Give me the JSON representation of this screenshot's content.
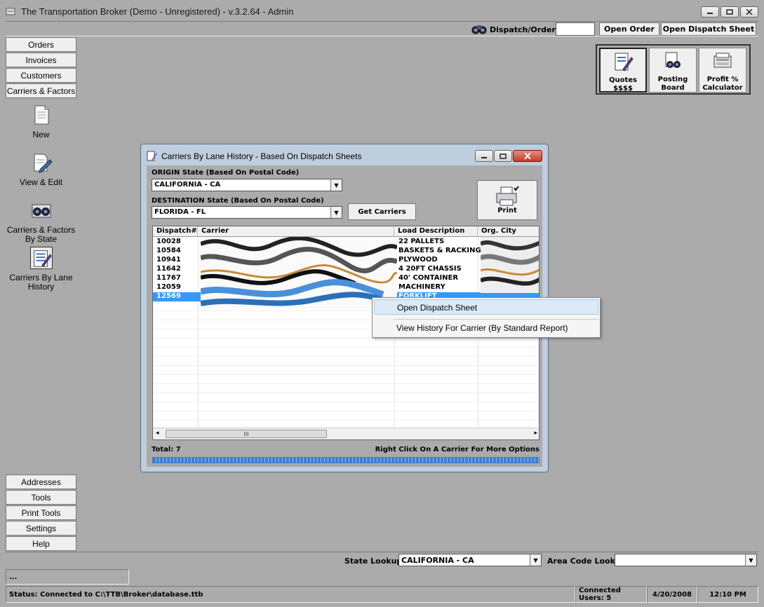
{
  "app": {
    "title": "The Transportation Broker (Demo - Unregistered) - v.3.2.64 - Admin"
  },
  "toolbar": {
    "dispatch_label": "Dispatch/Order #:",
    "dispatch_value": "",
    "open_order": "Open Order",
    "open_dispatch_sheet": "Open Dispatch Sheet"
  },
  "nav": {
    "top_buttons": [
      "Orders",
      "Invoices",
      "Customers",
      "Carriers & Factors"
    ],
    "icons": [
      {
        "label": "New",
        "icon": "new-document-icon"
      },
      {
        "label": "View & Edit",
        "icon": "edit-document-icon"
      },
      {
        "label": "Carriers & Factors By State",
        "icon": "truck-icon"
      },
      {
        "label": "Carriers By Lane History",
        "icon": "lane-history-icon"
      }
    ],
    "bottom_buttons": [
      "Addresses",
      "Tools",
      "Print Tools",
      "Settings",
      "Help"
    ]
  },
  "quick": {
    "quotes": "Quotes $$$$",
    "posting_board": "Posting Board",
    "profit_calc": "Profit % Calculator"
  },
  "dialog": {
    "title": "Carriers By Lane History - Based On Dispatch Sheets",
    "origin_label": "ORIGIN State (Based On Postal Code)",
    "origin_value": "CALIFORNIA - CA",
    "dest_label": "DESTINATION State (Based On Postal Code)",
    "dest_value": "FLORIDA - FL",
    "get_carriers": "Get Carriers",
    "print": "Print",
    "columns": [
      "Dispatch#",
      "Carrier",
      "Load Description",
      "Org. City"
    ],
    "rows": [
      {
        "dispatch": "10028",
        "load": "22 PALLETS"
      },
      {
        "dispatch": "10584",
        "load": "BASKETS & RACKING"
      },
      {
        "dispatch": "10941",
        "load": "PLYWOOD"
      },
      {
        "dispatch": "11642",
        "load": "4 20FT CHASSIS"
      },
      {
        "dispatch": "11767",
        "load": "40' CONTAINER"
      },
      {
        "dispatch": "12059",
        "load": "MACHINERY"
      },
      {
        "dispatch": "12569",
        "load": "FORKLIFT"
      }
    ],
    "selected_row": 6,
    "total": "Total: 7",
    "hint": "Right Click On A Carrier For More Options",
    "scroll_glyph": "III"
  },
  "context_menu": {
    "items": [
      "Open Dispatch Sheet",
      "View History For Carrier (By Standard Report)"
    ]
  },
  "bottom": {
    "state_lookup_label": "State Lookup:",
    "state_lookup_value": "CALIFORNIA - CA",
    "area_code_label": "Area Code Lookup:",
    "area_code_value": "",
    "ellipsis": "..."
  },
  "status": {
    "text": "Status: Connected to C:\\TTB\\Broker\\database.ttb",
    "users": "Connected Users: 5",
    "date": "4/20/2008",
    "time": "12:10 PM"
  },
  "colors": {
    "background": "#ababab",
    "selection": "#3399ff",
    "dialog_frame": "#bfcedd",
    "close_button": "#c4402a"
  }
}
